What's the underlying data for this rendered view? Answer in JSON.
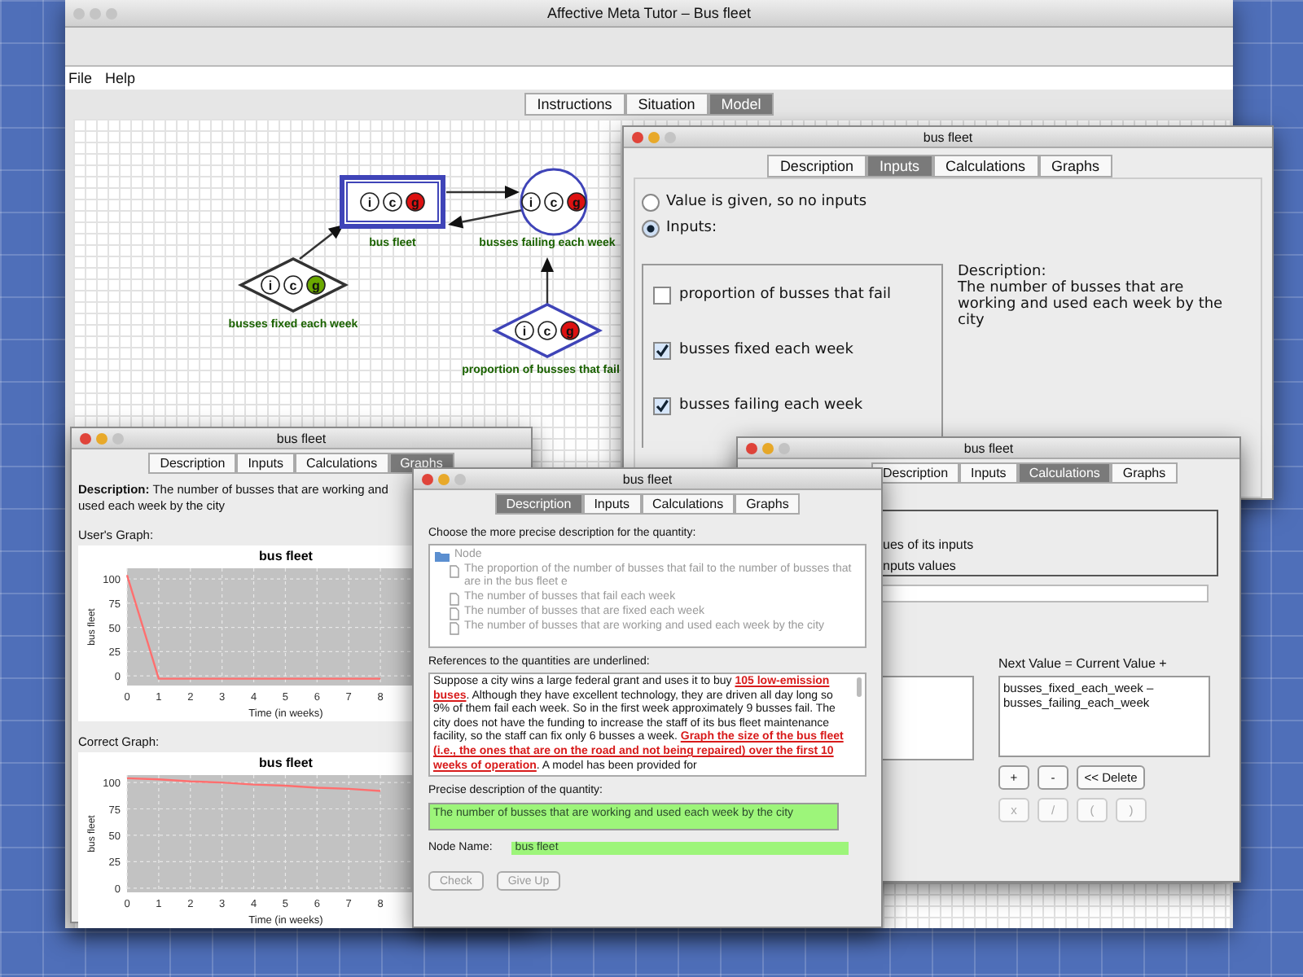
{
  "main_window": {
    "title": "Affective Meta Tutor – Bus fleet",
    "menu": [
      "File",
      "Help"
    ],
    "tabs": [
      {
        "label": "Instructions",
        "selected": false
      },
      {
        "label": "Situation",
        "selected": false
      },
      {
        "label": "Model",
        "selected": true
      }
    ]
  },
  "diagram": {
    "nodes": [
      {
        "kind": "rectangle",
        "label": "bus fleet",
        "highlighted": true,
        "badges": [
          {
            "text": "i",
            "color": "#ffffff"
          },
          {
            "text": "c",
            "color": "#ffffff"
          },
          {
            "text": "g",
            "color": "#dd1111"
          }
        ]
      },
      {
        "kind": "circle",
        "label": "busses failing each week",
        "highlighted": true,
        "badges": [
          {
            "text": "i",
            "color": "#ffffff"
          },
          {
            "text": "c",
            "color": "#ffffff"
          },
          {
            "text": "g",
            "color": "#dd1111"
          }
        ]
      },
      {
        "kind": "diamond",
        "label": "busses fixed each week",
        "highlighted": false,
        "badges": [
          {
            "text": "i",
            "color": "#ffffff"
          },
          {
            "text": "c",
            "color": "#ffffff"
          },
          {
            "text": "g",
            "color": "#6aa800"
          }
        ]
      },
      {
        "kind": "diamond",
        "label": "proportion of busses that fail",
        "highlighted": true,
        "badges": [
          {
            "text": "i",
            "color": "#ffffff"
          },
          {
            "text": "c",
            "color": "#ffffff"
          },
          {
            "text": "g",
            "color": "#dd1111"
          }
        ]
      }
    ]
  },
  "inputs_window": {
    "title": "bus fleet",
    "tabs": [
      {
        "label": "Description",
        "selected": false
      },
      {
        "label": "Inputs",
        "selected": true
      },
      {
        "label": "Calculations",
        "selected": false
      },
      {
        "label": "Graphs",
        "selected": false
      }
    ],
    "options": [
      {
        "label": "Value is given, so no inputs",
        "selected": false
      },
      {
        "label": "Inputs:",
        "selected": true
      }
    ],
    "inputs": [
      {
        "label": "proportion of busses that fail",
        "checked": false
      },
      {
        "label": "busses fixed each week",
        "checked": true
      },
      {
        "label": "busses failing each week",
        "checked": true
      }
    ],
    "description_heading": "Description:",
    "description": "The number of busses that are working and used each week by the city"
  },
  "graphs_window": {
    "title": "bus fleet",
    "tabs": [
      {
        "label": "Description",
        "selected": false
      },
      {
        "label": "Inputs",
        "selected": false
      },
      {
        "label": "Calculations",
        "selected": false
      },
      {
        "label": "Graphs",
        "selected": true
      }
    ],
    "description": "**Description:** The number of busses that are working and used each week by the city",
    "graphs": [
      {
        "heading": "User's Graph:",
        "chart_data": {
          "type": "line",
          "title": "bus fleet",
          "xlabel": "Time (in weeks)",
          "ylabel": "bus fleet",
          "x": [
            0,
            1,
            2,
            3,
            4,
            5,
            6,
            7,
            8
          ],
          "series": [
            {
              "color": "#ff6f6f",
              "values": [
                104,
                -3,
                -3,
                -3,
                -3,
                -3,
                -3,
                -3,
                -3
              ]
            }
          ],
          "xlim": [
            0,
            9
          ],
          "ylim": [
            -10,
            111
          ],
          "grid": true,
          "xticks": [
            0,
            1,
            2,
            3,
            4,
            5,
            6,
            7,
            8
          ],
          "yticks": [
            0,
            25,
            50,
            75,
            100
          ]
        }
      },
      {
        "heading": "Correct Graph:",
        "chart_data": {
          "type": "line",
          "title": "bus fleet",
          "xlabel": "Time (in weeks)",
          "ylabel": "bus fleet",
          "x": [
            0,
            1,
            2,
            3,
            4,
            5,
            6,
            7,
            8
          ],
          "series": [
            {
              "color": "#ff6f6f",
              "values": [
                104,
                103,
                101,
                100,
                98,
                97,
                95,
                94,
                92
              ]
            }
          ],
          "xlim": [
            0,
            9
          ],
          "ylim": [
            -4,
            107
          ],
          "grid": true,
          "xticks": [
            0,
            1,
            2,
            3,
            4,
            5,
            6,
            7,
            8
          ],
          "yticks": [
            0,
            25,
            50,
            75,
            100
          ]
        }
      }
    ]
  },
  "calculations_window": {
    "title": "bus fleet",
    "tabs": [
      {
        "label": "Description",
        "selected": false
      },
      {
        "label": "Inputs",
        "selected": false
      },
      {
        "label": "Calculations",
        "selected": true
      },
      {
        "label": "Graphs",
        "selected": false
      }
    ],
    "choice_fragments": [
      "ues of its inputs",
      "nputs values"
    ],
    "equation_label": "Next Value = Current Value +",
    "equation": "busses_fixed_each_week – busses_failing_each_week",
    "operators": [
      {
        "label": "+",
        "disabled": false
      },
      {
        "label": "-",
        "disabled": false
      },
      {
        "label": "<< Delete",
        "disabled": false
      },
      {
        "label": "x",
        "disabled": true
      },
      {
        "label": "/",
        "disabled": true
      },
      {
        "label": "(",
        "disabled": true
      },
      {
        "label": ")",
        "disabled": true
      }
    ]
  },
  "description_window": {
    "title": "bus fleet",
    "tabs": [
      {
        "label": "Description",
        "selected": true
      },
      {
        "label": "Inputs",
        "selected": false
      },
      {
        "label": "Calculations",
        "selected": false
      },
      {
        "label": "Graphs",
        "selected": false
      }
    ],
    "choose_label": "Choose the more precise description for the quantity:",
    "tree": {
      "label": "Node",
      "children": [
        {
          "label": "The proportion of the number of busses that fail to the number of busses that are in the bus fleet e"
        },
        {
          "label": "The number of busses that fail each week"
        },
        {
          "label": "The number of busses that are fixed each week"
        },
        {
          "label": "The number of busses that are working and used each week by the city"
        }
      ]
    },
    "references_label": "References to the quantities are underlined:",
    "story": "Suppose a city wins a large federal grant and uses it to buy **105 low-emission buses**. Although they have excellent technology, they are driven all day long so 9% of them fail each week. So in the first week approximately 9 busses fail. The city does not have the funding to increase the staff of its bus fleet maintenance facility, so the staff can fix only 6 busses a week. **Graph the size of the bus fleet (i.e., the ones that are on the road and not being repaired) over the first 10 weeks of operation**. A model has been provided for",
    "precise_label": "Precise description of the quantity:",
    "precise_value": "The number of busses that are working and used each week by the city",
    "precise_correct": true,
    "node_name_label": "Node Name:",
    "node_name": "bus fleet",
    "node_name_correct": true,
    "buttons": [
      {
        "label": "Check",
        "disabled": true
      },
      {
        "label": "Give Up",
        "disabled": true
      }
    ]
  }
}
